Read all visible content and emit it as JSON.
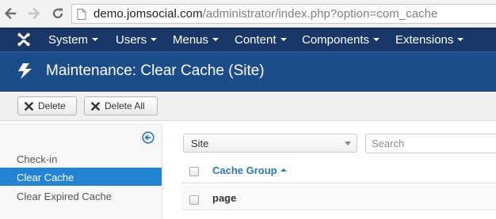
{
  "browser": {
    "url_domain": "demo.jomsocial.com",
    "url_path": "/administrator/index.php?option=com_cache"
  },
  "admin_menu": {
    "items": [
      "System",
      "Users",
      "Menus",
      "Content",
      "Components",
      "Extensions"
    ]
  },
  "page": {
    "title": "Maintenance: Clear Cache (Site)"
  },
  "toolbar": {
    "delete_label": "Delete",
    "delete_all_label": "Delete All"
  },
  "sidebar": {
    "items": [
      {
        "label": "Check-in",
        "active": false
      },
      {
        "label": "Clear Cache",
        "active": true
      },
      {
        "label": "Clear Expired Cache",
        "active": false
      }
    ]
  },
  "filters": {
    "client_select_value": "Site",
    "search_placeholder": "Search"
  },
  "table": {
    "column_header": "Cache Group",
    "sort_direction": "ascending",
    "rows": [
      {
        "group": "page"
      }
    ]
  },
  "colors": {
    "admin_menu_bg": "#1a3867",
    "title_bar_bg": "#1d4c8a",
    "sidebar_active": "#2384d3",
    "link": "#2a7ab8"
  },
  "icons": {
    "back": "arrow-left-icon",
    "forward": "arrow-right-icon",
    "reload": "reload-icon",
    "page": "page-icon",
    "logo": "joomla-logo-icon",
    "title": "lightning-bolt-icon",
    "delete": "close-icon",
    "collapse": "arrow-circle-left-icon"
  }
}
